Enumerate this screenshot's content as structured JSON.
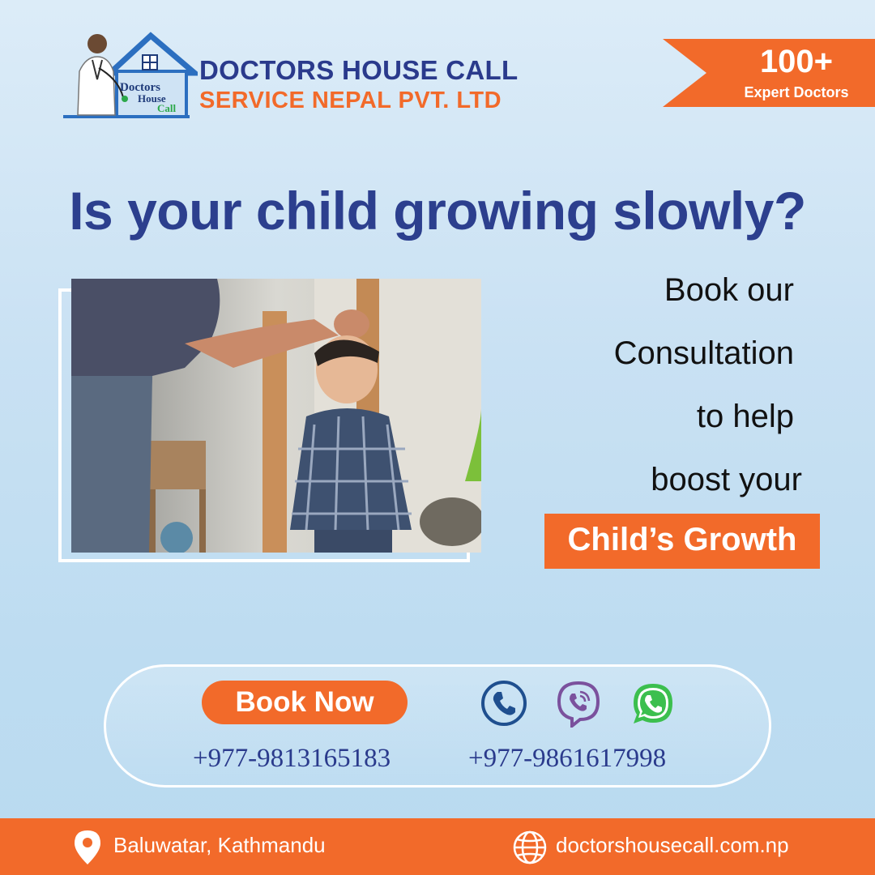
{
  "brand": {
    "logo_text": [
      "Doctors",
      "House",
      "Call"
    ],
    "name_line1": "DOCTORS HOUSE CALL",
    "name_line2": "SERVICE NEPAL PVT. LTD"
  },
  "badge": {
    "number": "100+",
    "label": "Expert Doctors"
  },
  "headline": "Is your child growing slowly?",
  "body_lines": [
    "Book our",
    "Consultation",
    "to help",
    "boost your"
  ],
  "highlight": "Child’s  Growth",
  "contact": {
    "book_label": "Book Now",
    "phone1": "+977-9813165183",
    "phone2": "+977-9861617998",
    "icons": [
      "phone-icon",
      "viber-icon",
      "whatsapp-icon"
    ]
  },
  "footer": {
    "address": "Baluwatar, Kathmandu",
    "website": "doctorshousecall.com.np"
  },
  "colors": {
    "brand_blue": "#2c3f8e",
    "accent_orange": "#f26a2a",
    "viber_purple": "#7b519d",
    "whatsapp_green": "#3cbf4e"
  }
}
